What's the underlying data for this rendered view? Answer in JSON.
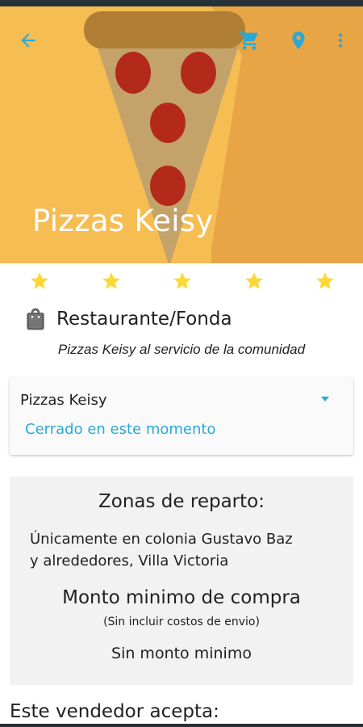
{
  "header": {
    "title": "Pizzas Keisy",
    "icons": {
      "back": "arrow-back-icon",
      "cart": "cart-icon",
      "location": "location-pin-icon",
      "menu": "more-vert-icon"
    },
    "colors": {
      "background": "#f6bd52",
      "accent": "#29a9d6",
      "title_text": "#ffffff"
    }
  },
  "rating": {
    "stars": 5,
    "max": 5,
    "color": "#fdd835"
  },
  "shop": {
    "category_icon": "shopping-bag-icon",
    "category": "Restaurante/Fonda",
    "tagline": "Pizzas Keisy al servicio de la comunidad"
  },
  "branch_selector": {
    "selected": "Pizzas Keisy",
    "status": "Cerrado en este momento",
    "status_color": "#29a9d6"
  },
  "delivery": {
    "zones_title": "Zonas de reparto:",
    "zones_line1": "Únicamente en colonia Gustavo Baz",
    "zones_line2": "y alrededores, Villa Victoria",
    "min_title": "Monto minimo de compra",
    "min_note": "(Sin incluir costos de envio)",
    "min_value": "Sin monto minimo"
  },
  "payments": {
    "heading": "Este vendedor acepta:"
  }
}
